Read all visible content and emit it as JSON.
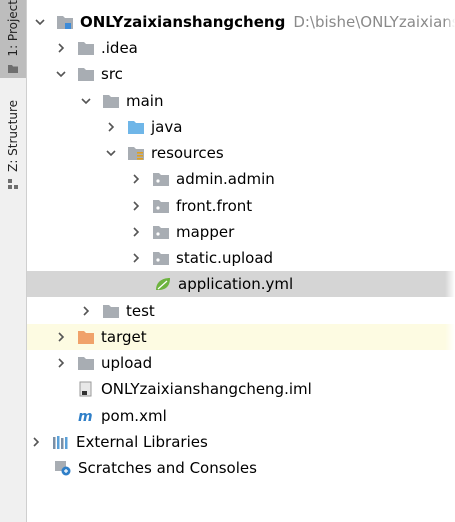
{
  "sidebar": {
    "project_tab": "1: Project",
    "structure_tab": "Z: Structure"
  },
  "tree": {
    "root": {
      "name": "ONLYzaixianshangcheng",
      "path": "D:\\bishe\\ONLYzaixiansh"
    },
    "idea": ".idea",
    "src": "src",
    "main": "main",
    "java": "java",
    "resources": "resources",
    "admin": "admin.admin",
    "front": "front.front",
    "mapper": "mapper",
    "static": "static.upload",
    "app_yml": "application.yml",
    "test": "test",
    "target": "target",
    "upload": "upload",
    "iml": "ONLYzaixianshangcheng.iml",
    "pom": "pom.xml",
    "external": "External Libraries",
    "scratches": "Scratches and Consoles"
  },
  "colors": {
    "folder": "#a8adb3",
    "source_folder": "#6fb6e8",
    "excluded_folder": "#f0a26a",
    "selection": "#d5d5d5",
    "excluded_bg": "#fdfbe2",
    "path_text": "#8a8a8a"
  }
}
